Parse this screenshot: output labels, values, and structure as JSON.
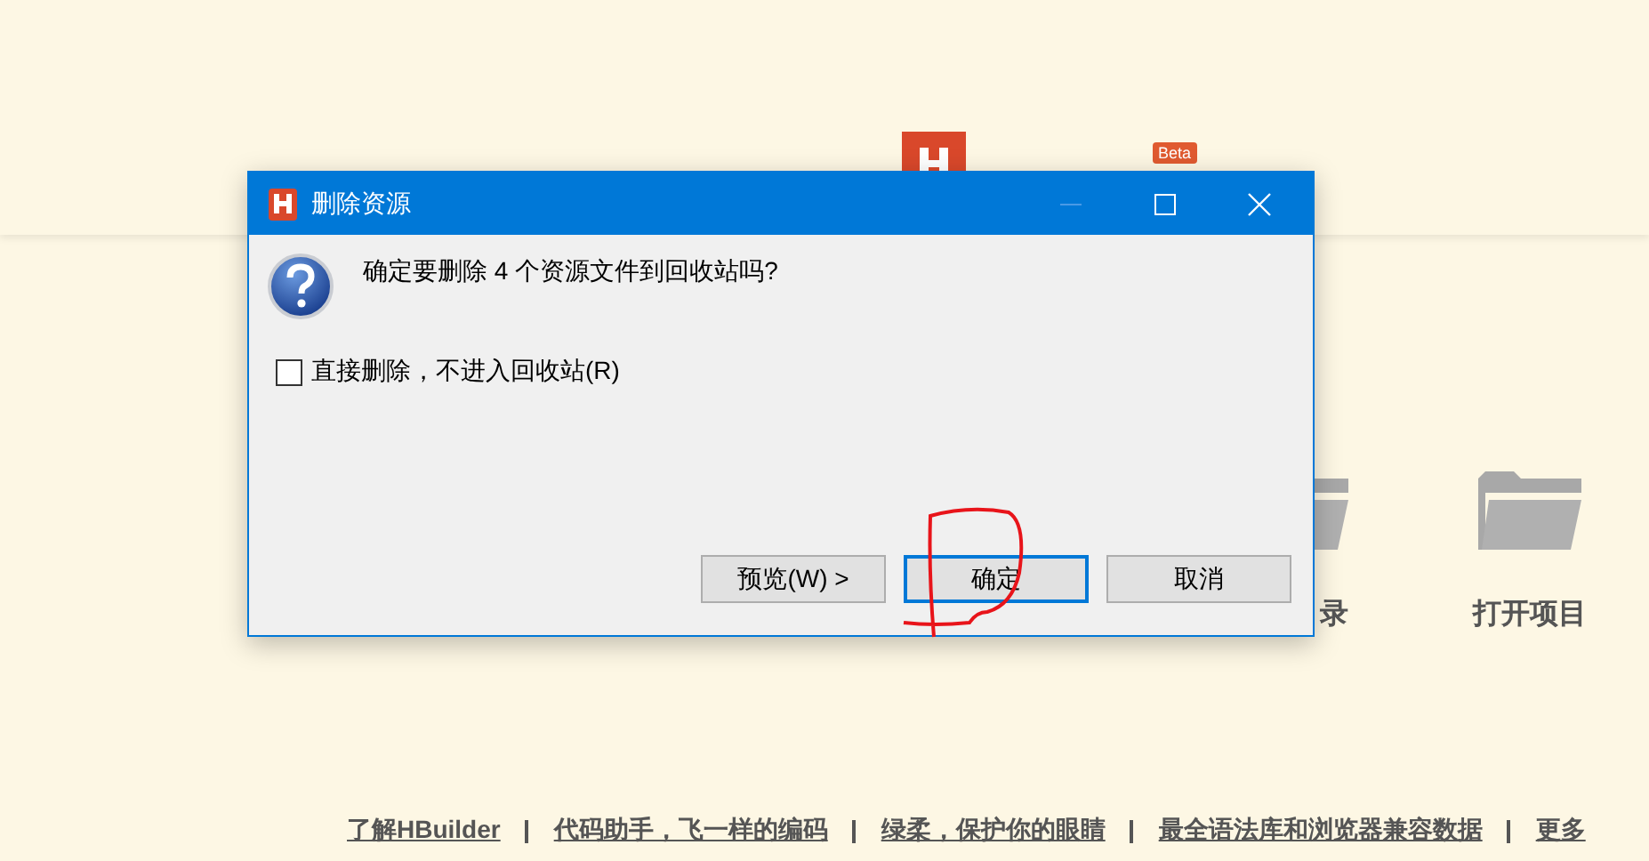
{
  "background": {
    "logo_badge": "Beta",
    "shortcuts": [
      {
        "label": "录"
      },
      {
        "label": "打开项目"
      }
    ],
    "footer_links": [
      "了解HBuilder",
      "代码助手，飞一样的编码",
      "绿柔，保护你的眼睛",
      "最全语法库和浏览器兼容数据",
      "更多"
    ]
  },
  "dialog": {
    "title": "删除资源",
    "message": "确定要删除 4 个资源文件到回收站吗?",
    "checkbox": {
      "label": "直接删除，不进入回收站(R)",
      "checked": false
    },
    "buttons": [
      {
        "label": "预览(W) >",
        "selected": false
      },
      {
        "label": "确定",
        "selected": true
      },
      {
        "label": "取消",
        "selected": false
      }
    ]
  }
}
